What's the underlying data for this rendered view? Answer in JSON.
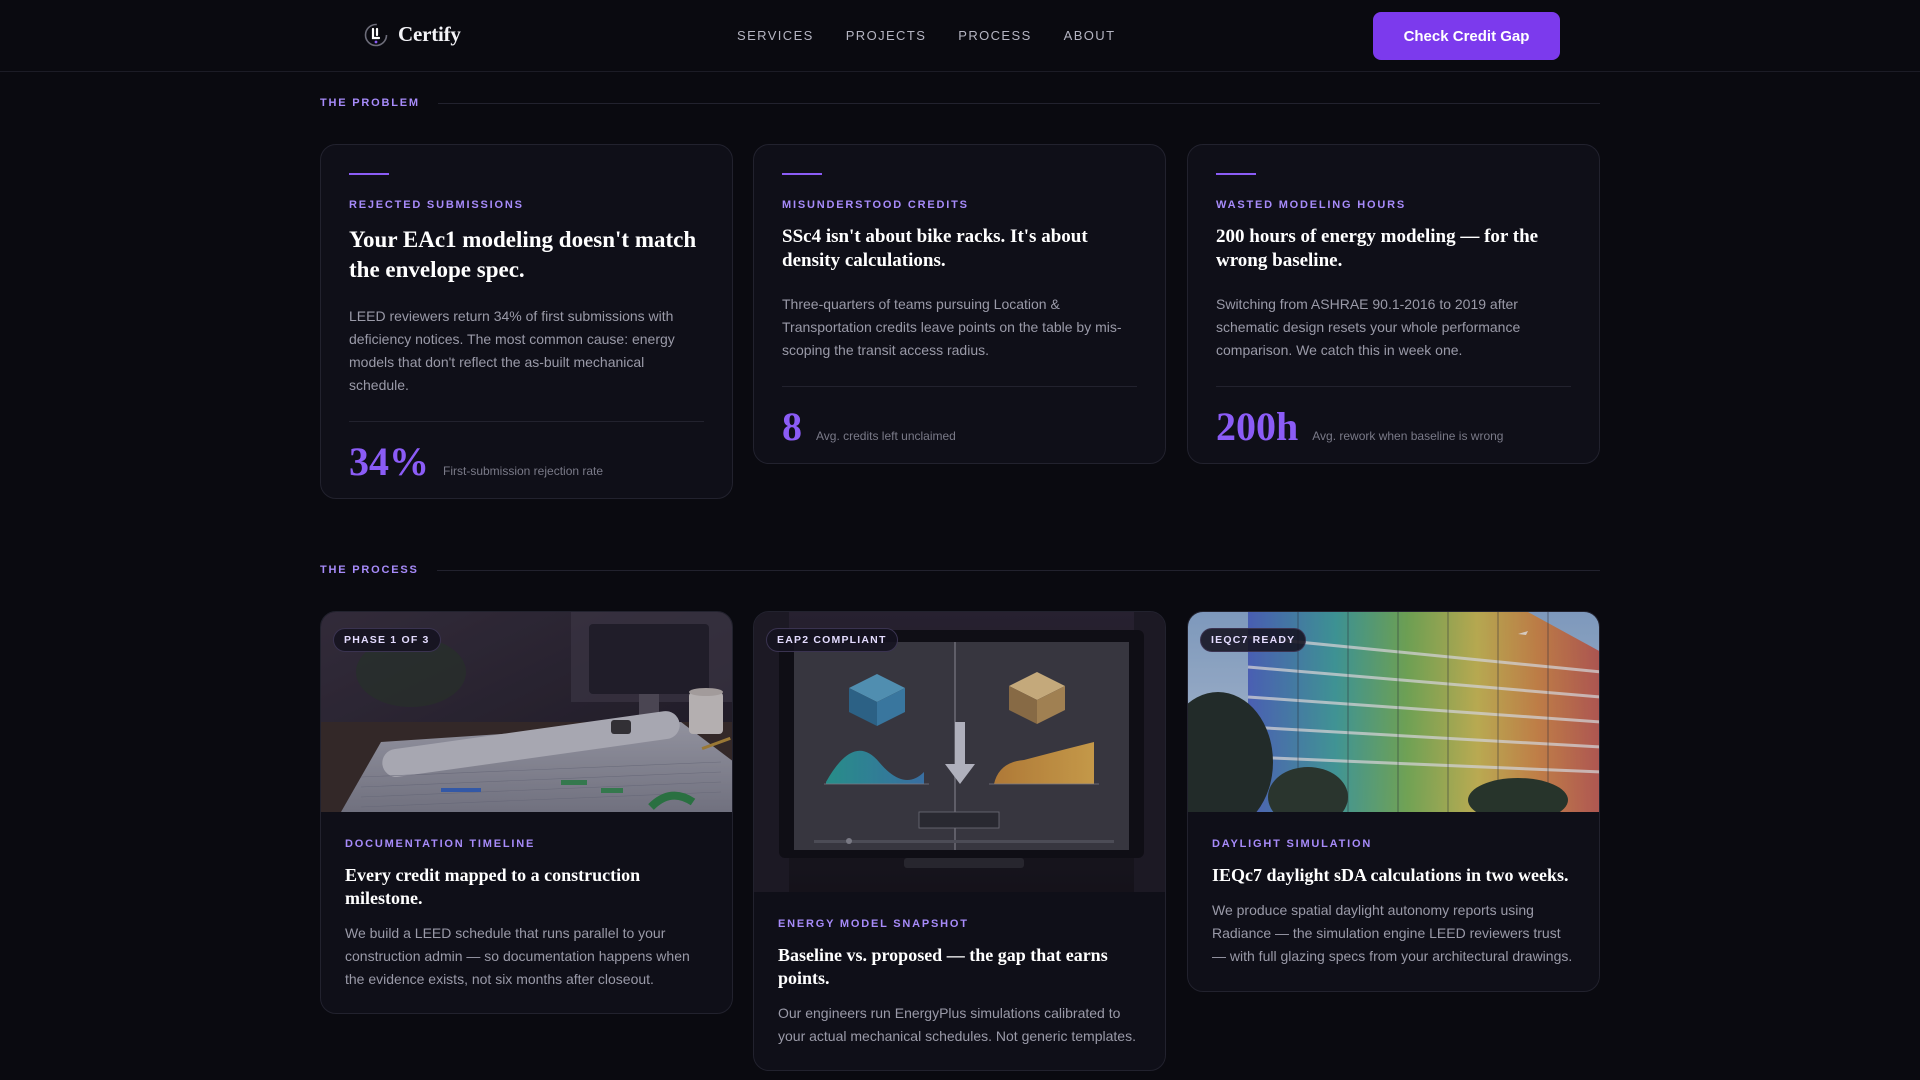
{
  "nav": {
    "brand": "Certify",
    "links": [
      "SERVICES",
      "PROJECTS",
      "PROCESS",
      "ABOUT"
    ],
    "cta": "Check Credit Gap"
  },
  "problem": {
    "label": "THE PROBLEM",
    "cards": [
      {
        "kicker": "REJECTED SUBMISSIONS",
        "title": "Your EAc1 modeling doesn't match the envelope spec.",
        "body": "LEED reviewers return 34% of first submissions with deficiency notices. The most common cause: energy models that don't reflect the as-built mechanical schedule.",
        "stat": "34%",
        "stat_caption": "First-submission rejection rate"
      },
      {
        "kicker": "MISUNDERSTOOD CREDITS",
        "title": "SSc4 isn't about bike racks. It's about density calculations.",
        "body": "Three-quarters of teams pursuing Location & Transportation credits leave points on the table by mis-scoping the transit access radius.",
        "stat": "8",
        "stat_caption": "Avg. credits left unclaimed"
      },
      {
        "kicker": "WASTED MODELING HOURS",
        "title": "200 hours of energy modeling — for the wrong baseline.",
        "body": "Switching from ASHRAE 90.1-2016 to 2019 after schematic design resets your whole performance comparison. We catch this in week one.",
        "stat": "200h",
        "stat_caption": "Avg. rework when baseline is wrong"
      }
    ]
  },
  "process": {
    "label": "THE PROCESS",
    "cards": [
      {
        "badge": "PHASE 1 OF 3",
        "kicker": "DOCUMENTATION TIMELINE",
        "title": "Every credit mapped to a construction milestone.",
        "body": "We build a LEED schedule that runs parallel to your construction admin — so documentation happens when the evidence exists, not six months after closeout."
      },
      {
        "badge": "EAP2 COMPLIANT",
        "kicker": "ENERGY MODEL SNAPSHOT",
        "title": "Baseline vs. proposed — the gap that earns points.",
        "body": "Our engineers run EnergyPlus simulations calibrated to your actual mechanical schedules. Not generic templates."
      },
      {
        "badge": "IEQC7 READY",
        "kicker": "DAYLIGHT SIMULATION",
        "title": "IEQc7 daylight sDA calculations in two weeks.",
        "body": "We produce spatial daylight autonomy reports using Radiance — the simulation engine LEED reviewers trust — with full glazing specs from your architectural drawings."
      }
    ]
  },
  "colors": {
    "background": "#0a0a10",
    "accent": "#7c3aed",
    "accent_text": "#a78bfa",
    "card": "#0f0f18"
  },
  "icons": {
    "brand_logo": "certify-logo-icon"
  }
}
